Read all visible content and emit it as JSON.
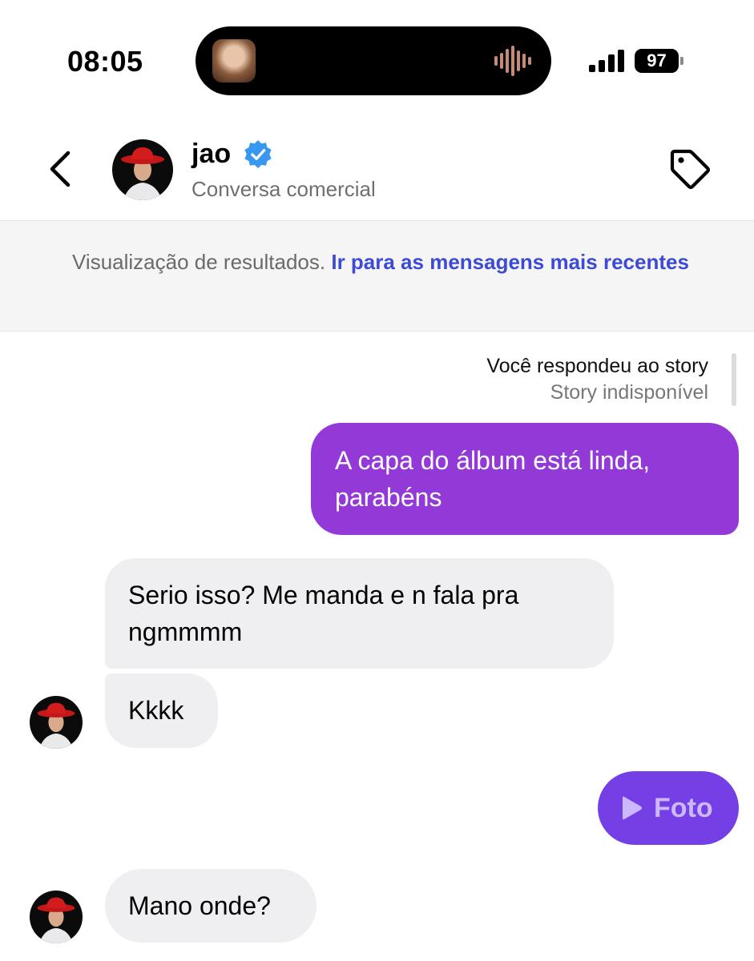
{
  "status_bar": {
    "time": "08:05",
    "battery": "97"
  },
  "header": {
    "name": "jao",
    "subtitle": "Conversa comercial"
  },
  "banner": {
    "text": "Visualização de resultados.",
    "link": "Ir para as mensagens mais recentes"
  },
  "story_reply": {
    "title": "Você respondeu ao story",
    "subtitle": "Story indisponível"
  },
  "messages": [
    {
      "from": "me",
      "text": "A capa do álbum está linda, parabéns"
    },
    {
      "from": "them",
      "text": "Serio isso? Me manda e n fala pra ngmmmm"
    },
    {
      "from": "them",
      "text": "Kkkk"
    },
    {
      "from": "me",
      "type": "video",
      "text": "Foto"
    },
    {
      "from": "them",
      "text": "Mano onde?"
    }
  ],
  "colors": {
    "sent_bubble": "#9239d8",
    "media_bubble": "#7440e6",
    "received_bubble": "#efeff1",
    "link": "#3d4bd4",
    "verified": "#3897f0"
  },
  "icons": [
    "back-chevron-icon",
    "verified-badge-icon",
    "tag-icon",
    "audio-wave-icon",
    "signal-icon",
    "play-icon"
  ]
}
